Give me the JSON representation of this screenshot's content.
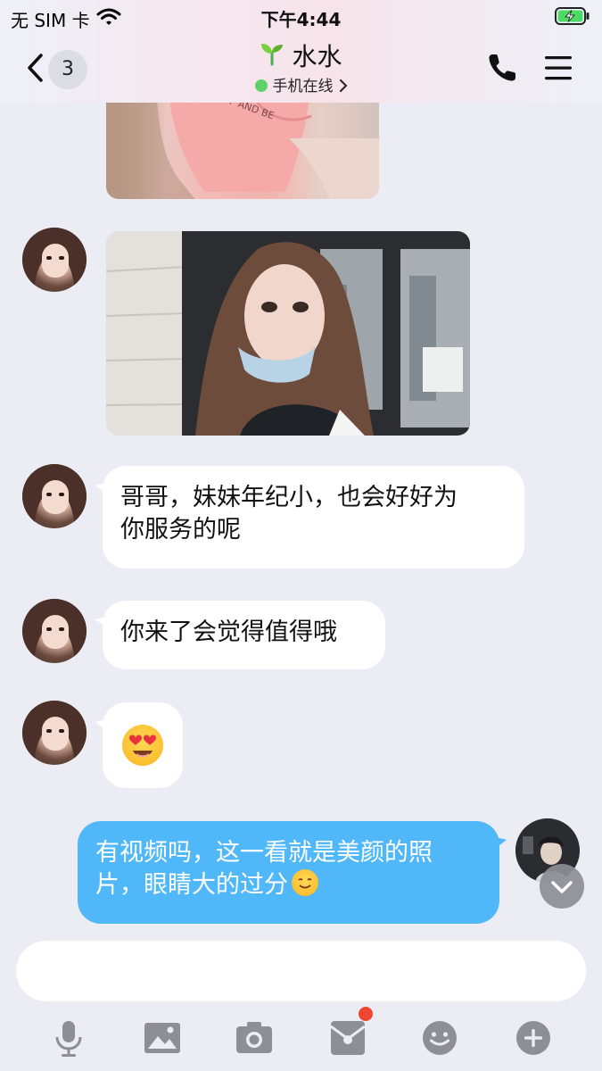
{
  "status_bar": {
    "carrier": "无 SIM 卡",
    "time": "下午4:44",
    "battery_state": "charging"
  },
  "header": {
    "unread_count": "3",
    "contact_name": "水水",
    "presence": "手机在线",
    "presence_color": "#5fd16a"
  },
  "messages": [
    {
      "type": "image",
      "direction": "incoming",
      "depiction": "photo-pink-shirt"
    },
    {
      "type": "image",
      "direction": "incoming",
      "depiction": "selfie-with-mask"
    },
    {
      "type": "text",
      "direction": "incoming",
      "line1": "哥哥，妹妹年纪小，也会好好为",
      "line2": "你服务的呢"
    },
    {
      "type": "text",
      "direction": "incoming",
      "text": "你来了会觉得值得哦"
    },
    {
      "type": "emoji",
      "direction": "incoming",
      "emoji": "heart-eyes-emoji"
    },
    {
      "type": "text",
      "direction": "outgoing",
      "line1": "有视频吗，这一看就是美颜的照",
      "line2": "片，眼睛大的过分"
    }
  ],
  "input": {
    "placeholder": ""
  },
  "toolbar": [
    "microphone-icon",
    "image-icon",
    "camera-icon",
    "red-packet-icon",
    "emoji-icon",
    "plus-icon"
  ],
  "colors": {
    "outgoing_bubble": "#50b8f8",
    "incoming_bubble": "#ffffff",
    "background": "#ecedf4",
    "notification_dot": "#f0452f"
  }
}
